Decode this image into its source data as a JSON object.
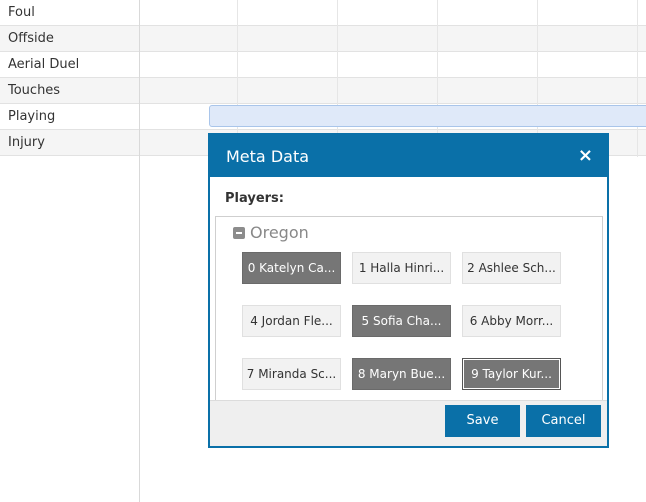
{
  "rows": [
    {
      "label": "Foul"
    },
    {
      "label": "Offside"
    },
    {
      "label": "Aerial Duel"
    },
    {
      "label": "Touches"
    },
    {
      "label": "Playing"
    },
    {
      "label": "Injury"
    }
  ],
  "modal": {
    "title": "Meta Data",
    "close_icon": "×",
    "players_label": "Players:",
    "group": {
      "name": "Oregon",
      "icon": "collapse-icon",
      "players": [
        {
          "label": "0 Katelyn Ca...",
          "selected": true
        },
        {
          "label": "1 Halla Hinri...",
          "selected": false
        },
        {
          "label": "2 Ashlee Sch...",
          "selected": false
        },
        {
          "label": "4 Jordan Fle...",
          "selected": false
        },
        {
          "label": "5 Sofia Cha...",
          "selected": true
        },
        {
          "label": "6 Abby Morr...",
          "selected": false
        },
        {
          "label": "7 Miranda Sc...",
          "selected": false
        },
        {
          "label": "8 Maryn Bue...",
          "selected": true
        },
        {
          "label": "9 Taylor Kur...",
          "selected": true
        }
      ]
    },
    "save_label": "Save",
    "cancel_label": "Cancel"
  },
  "colors": {
    "accent": "#0a70a8",
    "selected_player": "#767676",
    "playing_bar": "#dfe9f9"
  }
}
